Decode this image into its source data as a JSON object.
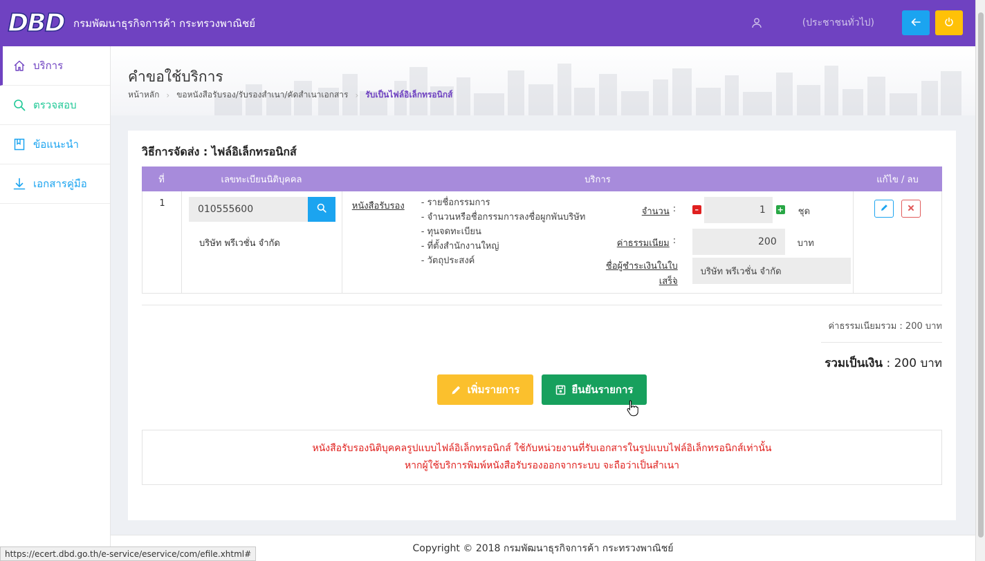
{
  "header": {
    "logo_text": "DBD",
    "org_name": "กรมพัฒนาธุรกิจการค้า กระทรวงพาณิชย์",
    "user_role": "(ประชาชนทั่วไป)",
    "back_icon": "arrow-left-icon",
    "power_icon": "power-icon",
    "colors": {
      "bar": "#6f42c1",
      "back_button": "#1ba4f0",
      "power_button": "#ffc107"
    }
  },
  "sidebar": {
    "items": [
      {
        "label": "บริการ",
        "icon": "home-icon"
      },
      {
        "label": "ตรวจสอบ",
        "icon": "search-icon"
      },
      {
        "label": "ข้อแนะนำ",
        "icon": "book-icon"
      },
      {
        "label": "เอกสารคู่มือ",
        "icon": "download-icon"
      }
    ]
  },
  "page": {
    "title": "คำขอใช้บริการ",
    "breadcrumbs": [
      "หน้าหลัก",
      "ขอหนังสือรับรอง/รับรองสำเนา/คัดสำเนาเอกสาร",
      "รับเป็นไฟล์อิเล็กทรอนิกส์"
    ]
  },
  "card": {
    "title": "วิธีการจัดส่ง : ไฟล์อิเล็กทรอนิกส์",
    "table": {
      "headers": [
        "ที่",
        "เลขทะเบียนนิติบุคคล",
        "บริการ",
        "แก้ไข / ลบ"
      ],
      "row": {
        "no": "1",
        "reg_no": "010555600",
        "company": "บริษัท พรีเวชั่น จำกัด",
        "service_link": "หนังสือรับรอง",
        "service_items": [
          "- รายชื่อกรรมการ",
          "- จำนวนหรือชื่อกรรมการลงชื่อผูกพันบริษัท",
          "- ทุนจดทะเบียน",
          "- ที่ตั้งสำนักงานใหญ่",
          "- วัตถุประสงค์"
        ],
        "qty_label": "จำนวน",
        "qty_value": "1",
        "qty_unit": "ชุด",
        "fee_label": "ค่าธรรมเนียม",
        "fee_value": "200",
        "fee_unit": "บาท",
        "payer_label_1": "ชื่อผู้ชำระเงินในใบ",
        "payer_label_2": "เสร็จ",
        "colon": ":",
        "payer_value": "บริษัท พรีเวชั่น จำกัด"
      }
    },
    "fee_total": "ค่าธรรมเนียมรวม : 200 บาท",
    "grand_label": "รวมเป็นเงิน",
    "grand_value": " : 200 บาท",
    "add_button": "เพิ่มรายการ",
    "confirm_button": "ยืนยันรายการ",
    "notice_1": "หนังสือรับรองนิติบุคคลรูปแบบไฟล์อิเล็กทรอนิกส์ ใช้กับหน่วยงานที่รับเอกสารในรูปแบบไฟล์อิเล็กทรอนิกส์เท่านั้น",
    "notice_2": "หากผู้ใช้บริการพิมพ์หนังสือรับรองออกจากระบบ จะถือว่าเป็นสำเนา"
  },
  "footer": {
    "copyright": "Copyright © 2018 กรมพัฒนาธุรกิจการค้า กระทรวงพาณิชย์"
  },
  "status_url": "https://ecert.dbd.go.th/e-service/eservice/com/efile.xhtml#"
}
